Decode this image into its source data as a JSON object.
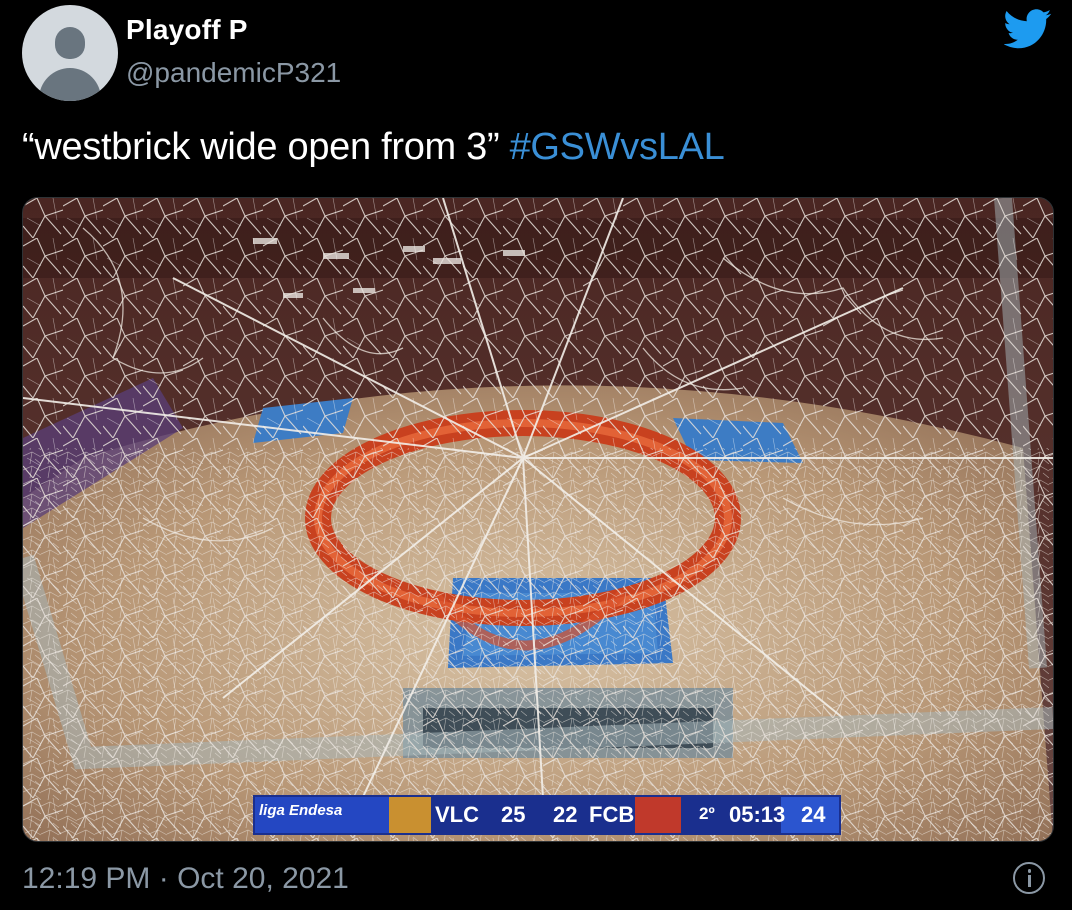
{
  "tweet": {
    "display_name": "Playoff P",
    "handle": "@pandemicP321",
    "text": "“westbrick wide open from 3”",
    "hashtag": "#GSWvsLAL",
    "timestamp": "12:19 PM · Oct 20, 2021"
  },
  "icons": {
    "avatar": "default-avatar-icon",
    "brand": "twitter-bird-icon",
    "info": "info-icon"
  },
  "media": {
    "scoreboard": {
      "sponsor": "liga Endesa",
      "home_team": "VLC",
      "home_score": "25",
      "away_score": "22",
      "away_team": "FCB",
      "period": "2º",
      "clock": "05:13",
      "shot_clock": "24"
    }
  },
  "colors": {
    "background": "#000000",
    "text_primary": "#ffffff",
    "text_secondary": "#8b98a5",
    "hashtag": "#3a8fd6",
    "twitter_blue": "#1d9bf0",
    "rim_orange": "#d9502a",
    "scoreboard_blue": "#1f3fae"
  }
}
